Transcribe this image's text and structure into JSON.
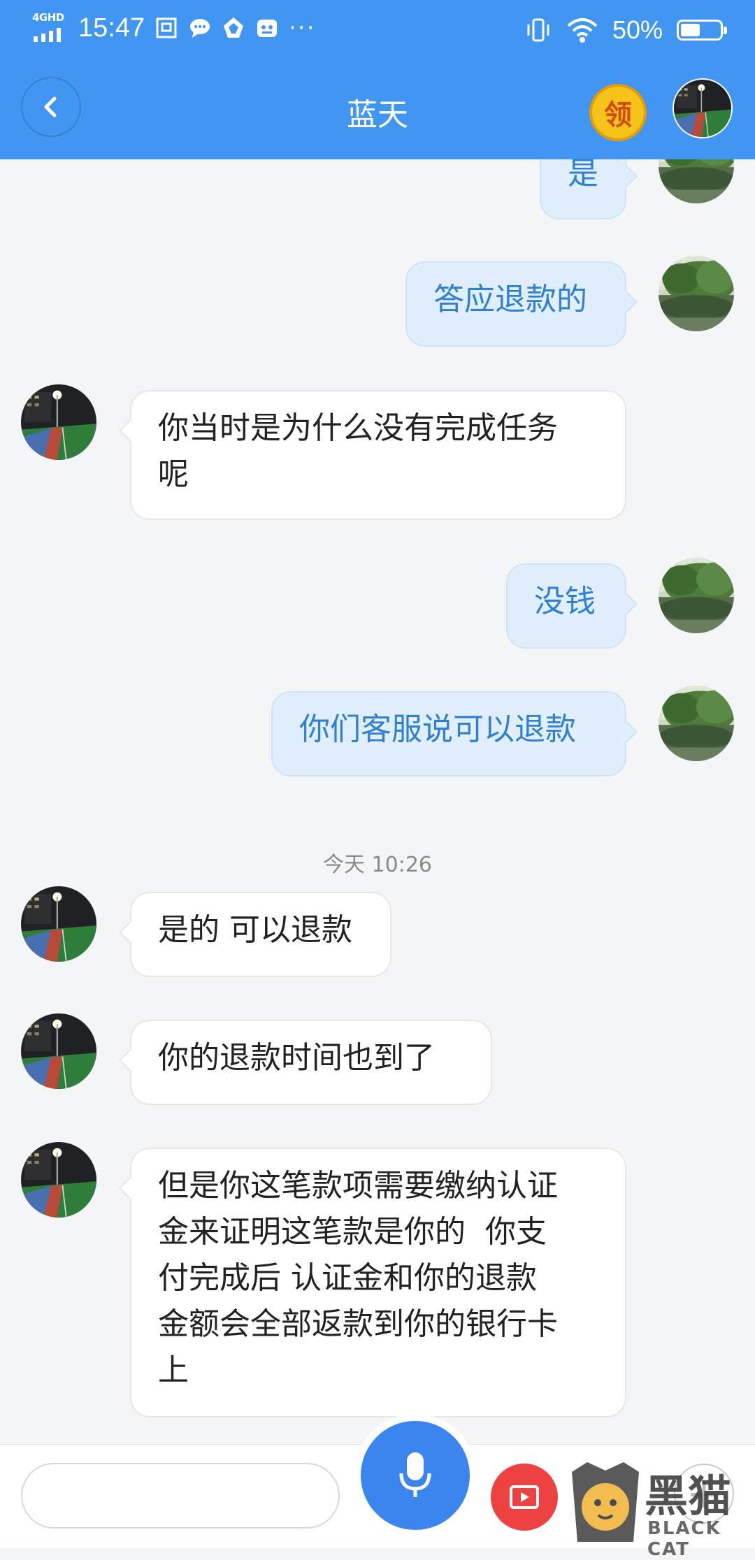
{
  "status_bar": {
    "network": "4GHD",
    "time": "15:47",
    "battery_text": "50%",
    "battery_level": 0.5,
    "icons": [
      "data-saver-icon",
      "message-icon",
      "app-icon",
      "game-icon",
      "more-dots-icon",
      "vibrate-icon",
      "wifi-icon",
      "battery-icon"
    ],
    "dots": "···"
  },
  "header": {
    "title": "蓝天",
    "coin_label": "领",
    "back_icon": "chevron-left-icon"
  },
  "messages": [
    {
      "side": "me",
      "text": "是",
      "avatar": "lake-trees-avatar"
    },
    {
      "side": "me",
      "text": "答应退款的",
      "avatar": "lake-trees-avatar"
    },
    {
      "side": "other",
      "text": "你当时是为什么没有完成任务\n呢",
      "avatar": "night-field-avatar"
    },
    {
      "side": "me",
      "text": "没钱",
      "avatar": "lake-trees-avatar"
    },
    {
      "side": "me",
      "text": "你们客服说可以退款",
      "avatar": "lake-trees-avatar"
    },
    {
      "side": "other",
      "text": "是的 可以退款",
      "avatar": "night-field-avatar"
    },
    {
      "side": "other",
      "text": "你的退款时间也到了",
      "avatar": "night-field-avatar"
    },
    {
      "side": "other",
      "text": "但是你这笔款项需要缴纳认证\n金来证明这笔款是你的  你支\n付完成后 认证金和你的退款\n金额会全部返款到你的银行卡\n上",
      "avatar": "night-field-avatar"
    }
  ],
  "timestamp": "今天 10:26",
  "input_bar": {
    "placeholder": "",
    "mic_icon": "microphone-icon",
    "video_icon": "video-icon",
    "plus_icon": "plus-icon"
  },
  "watermark": {
    "text": "黑猫",
    "subtext": "BLACK CAT"
  },
  "colors": {
    "header_bg": "#4196f2",
    "my_bubble_bg": "#e1effd",
    "my_bubble_text": "#2f7fd4",
    "page_bg": "#f4f5f7",
    "mic_bg": "#3b86ee",
    "video_bg": "#ee4242"
  }
}
